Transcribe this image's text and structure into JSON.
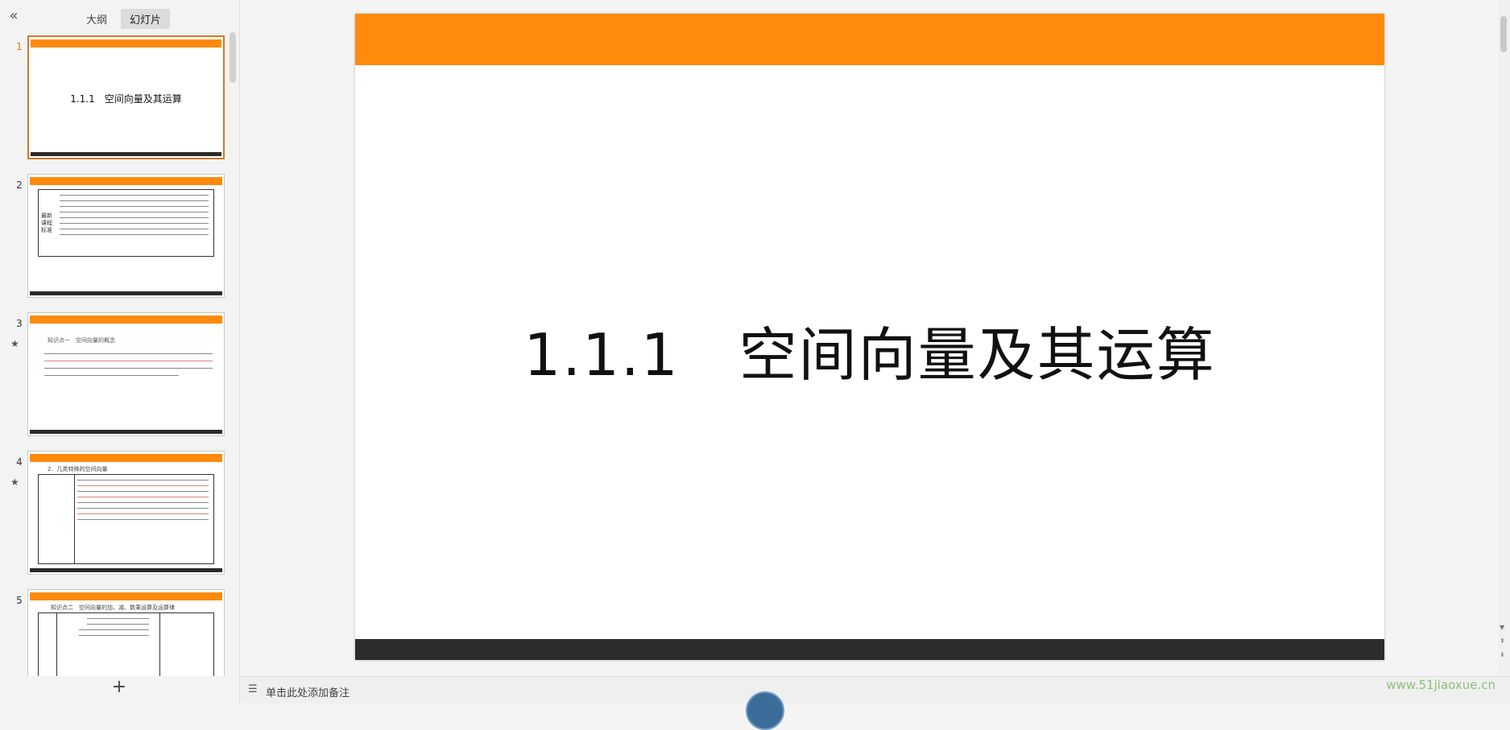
{
  "left_panel": {
    "collapse_icon": "double-chevron-left-icon",
    "collapse_glyph": "«",
    "tabs": [
      {
        "label": "大纲",
        "active": false
      },
      {
        "label": "幻灯片",
        "active": true
      }
    ],
    "add_glyph": "+"
  },
  "thumbnails": [
    {
      "number": "1",
      "title": "1.1.1　空间向量及其运算",
      "starred": false,
      "active": true
    },
    {
      "number": "2",
      "mini": "最新课程标准",
      "starred": false,
      "active": false
    },
    {
      "number": "3",
      "mini": "知识点一　空间向量的概念",
      "starred": true,
      "active": false
    },
    {
      "number": "4",
      "mini": "2．几类特殊的空间向量",
      "starred": true,
      "active": false
    },
    {
      "number": "5",
      "mini": "知识点二　空间向量的加、减、数乘运算及运算律",
      "starred": false,
      "active": false
    }
  ],
  "star_glyph": "★",
  "slide": {
    "title": "1.1.1　空间向量及其运算",
    "colors": {
      "accent": "#ff8a0c",
      "footer": "#2c2c2c"
    }
  },
  "notes": {
    "icon": "notes-list-icon",
    "icon_glyph": "☰",
    "placeholder": "单击此处添加备注"
  },
  "watermark": "www.51jiaoxue.cn"
}
